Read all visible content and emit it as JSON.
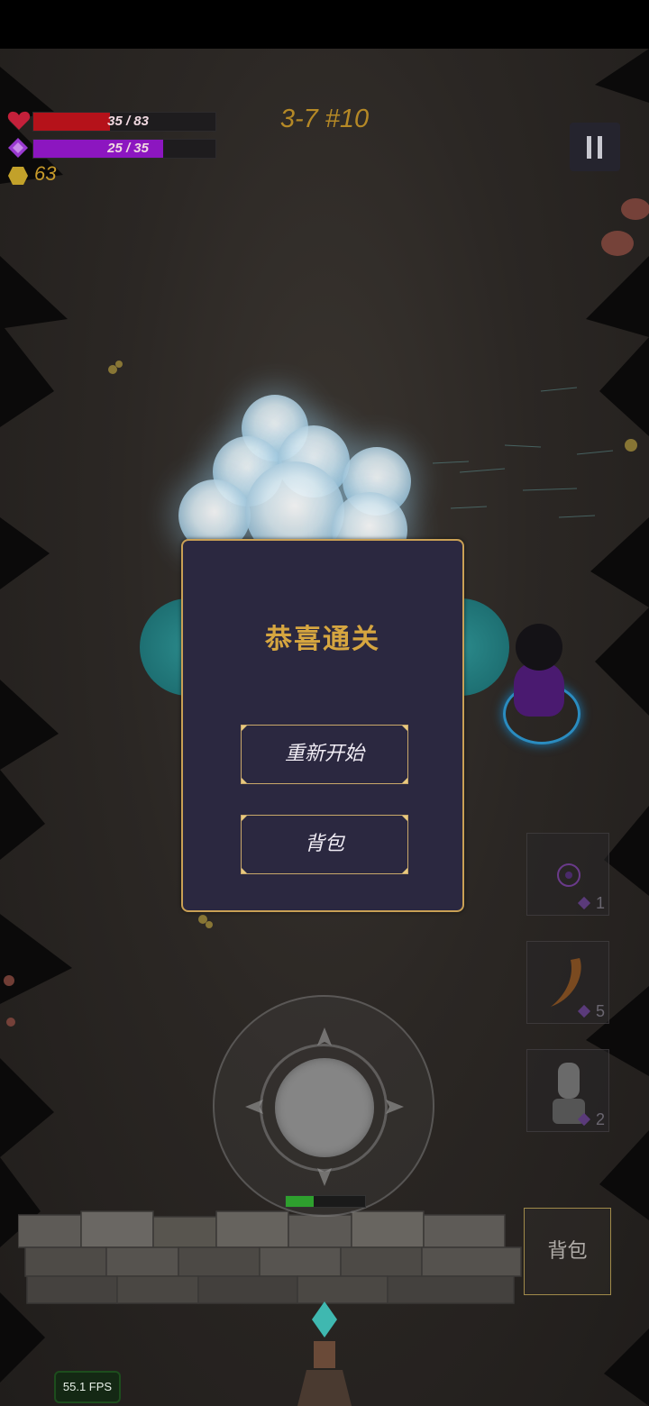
{
  "hud": {
    "health": {
      "current": 35,
      "max": 83,
      "label": "35 / 83",
      "icon": "heart-icon",
      "color": "#b5121a"
    },
    "mana": {
      "current": 25,
      "max": 35,
      "label": "25 / 35",
      "icon": "crystal-icon",
      "color": "#8c16c0"
    },
    "gold": {
      "value": "63",
      "icon": "coin-icon",
      "color": "#c79a2a"
    },
    "level": "3-7 #10",
    "pause_icon": "pause-icon"
  },
  "dialog": {
    "title": "恭喜通关",
    "restart_label": "重新开始",
    "bag_label": "背包",
    "accent": "#c9a055"
  },
  "skills": [
    {
      "icon": "magic-circle-icon",
      "cost": "1"
    },
    {
      "icon": "horn-icon",
      "cost": "5"
    },
    {
      "icon": "statue-icon",
      "cost": "2"
    }
  ],
  "side_bag_label": "背包",
  "fps": "55.1 FPS",
  "wave_progress": 0.35
}
